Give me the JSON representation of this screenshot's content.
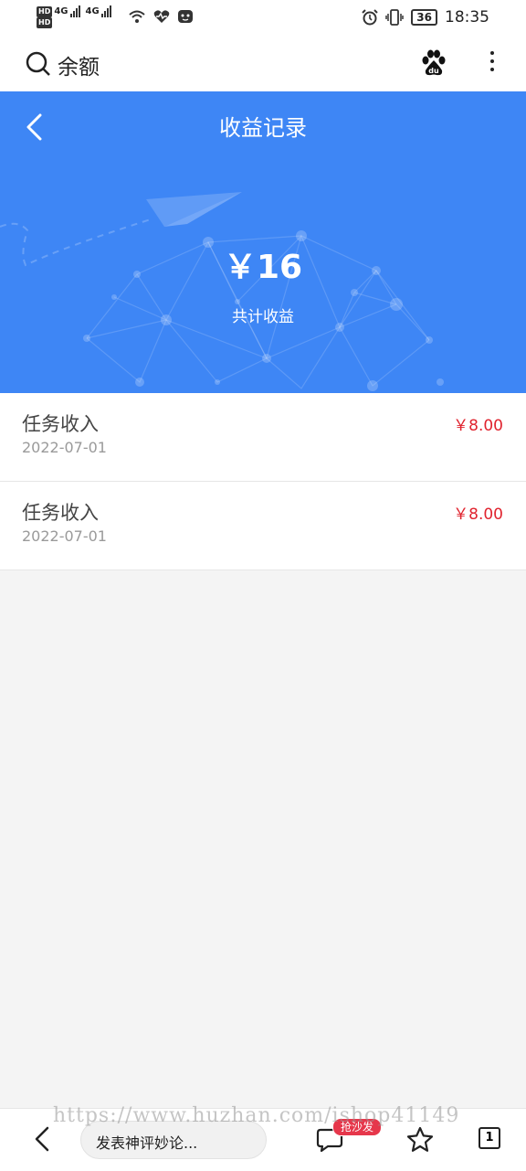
{
  "status_bar": {
    "hd1": "HD",
    "hd2": "HD",
    "net1": "4G",
    "net2": "4G",
    "battery": "36",
    "time": "18:35"
  },
  "browser": {
    "title": "余额"
  },
  "page": {
    "title": "收益记录",
    "total_amount": "￥16",
    "total_label": "共计收益"
  },
  "records": [
    {
      "title": "任务收入",
      "date": "2022-07-01",
      "amount": "￥8.00"
    },
    {
      "title": "任务收入",
      "date": "2022-07-01",
      "amount": "￥8.00"
    }
  ],
  "bottom_bar": {
    "comment_placeholder": "发表神评妙论...",
    "sofa_badge": "抢沙发",
    "tab_count": "1"
  },
  "watermark": "https://www.huzhan.com/ishop41149",
  "colors": {
    "hero_bg": "#3e86f5",
    "amount_red": "#e0232e",
    "badge_red": "#e6374b"
  }
}
